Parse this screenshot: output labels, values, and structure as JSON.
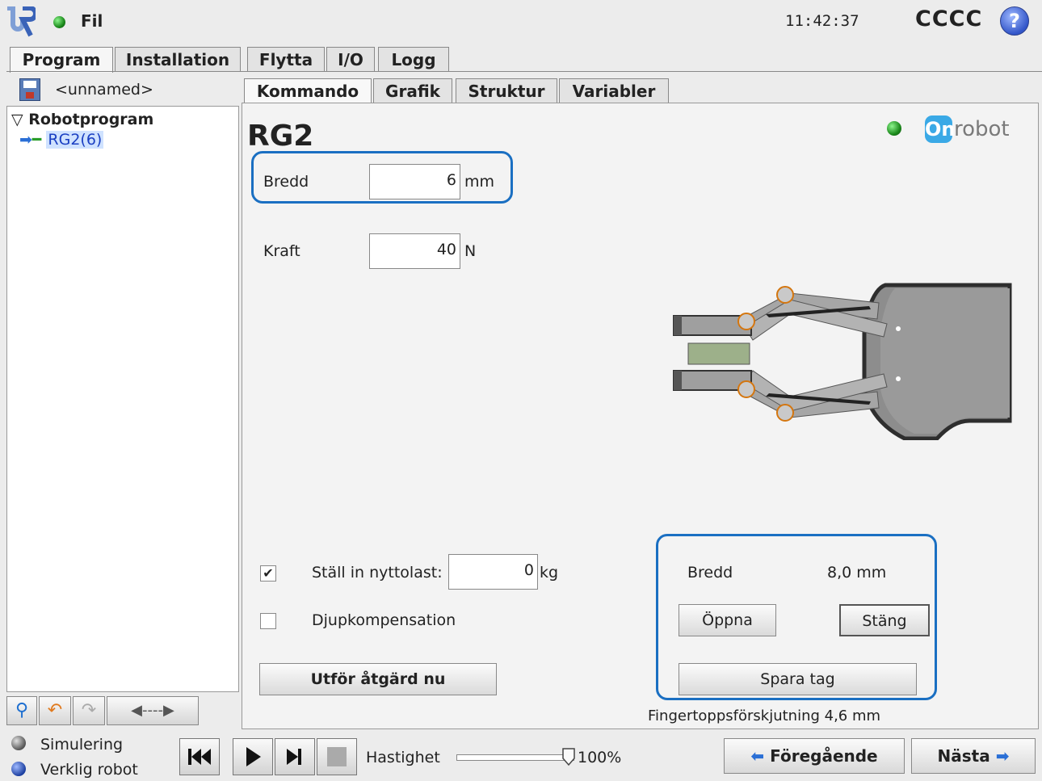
{
  "topbar": {
    "menu_label": "Fil",
    "time": "11:42:37",
    "robot_name": "CCCC",
    "help_glyph": "?"
  },
  "main_tabs": [
    "Program",
    "Installation",
    "Flytta",
    "I/O",
    "Logg"
  ],
  "left": {
    "file_name": "<unnamed>",
    "tree_root": "Robotprogram",
    "tree_child": "RG2(6)"
  },
  "sub_tabs": [
    "Kommando",
    "Grafik",
    "Struktur",
    "Variabler"
  ],
  "command": {
    "title": "RG2",
    "brand": "robot",
    "brand_box": "On",
    "width_label": "Bredd",
    "width_value": "6",
    "width_unit": "mm",
    "force_label": "Kraft",
    "force_value": "40",
    "force_unit": "N",
    "payload_label": "Ställ in nyttolast:",
    "payload_value": "0",
    "payload_unit": "kg",
    "payload_checked": true,
    "depth_label": "Djupkompensation",
    "depth_checked": false,
    "execute_label": "Utför åtgärd nu",
    "status_width_label": "Bredd",
    "status_width_value": "8,0 mm",
    "open_label": "Öppna",
    "close_label": "Stäng",
    "save_grip_label": "Spara tag",
    "fingertip_offset": "Fingertoppsförskjutning 4,6 mm"
  },
  "footer": {
    "sim_label": "Simulering",
    "real_label": "Verklig robot",
    "speed_label": "Hastighet",
    "speed_value": "100%",
    "speed_fraction": 1.0,
    "prev_label": "Föregående",
    "next_label": "Nästa"
  },
  "colors": {
    "accent": "#1a6fc2",
    "selected_bg": "#cfe2ff",
    "status_green": "#1c8a1c"
  }
}
